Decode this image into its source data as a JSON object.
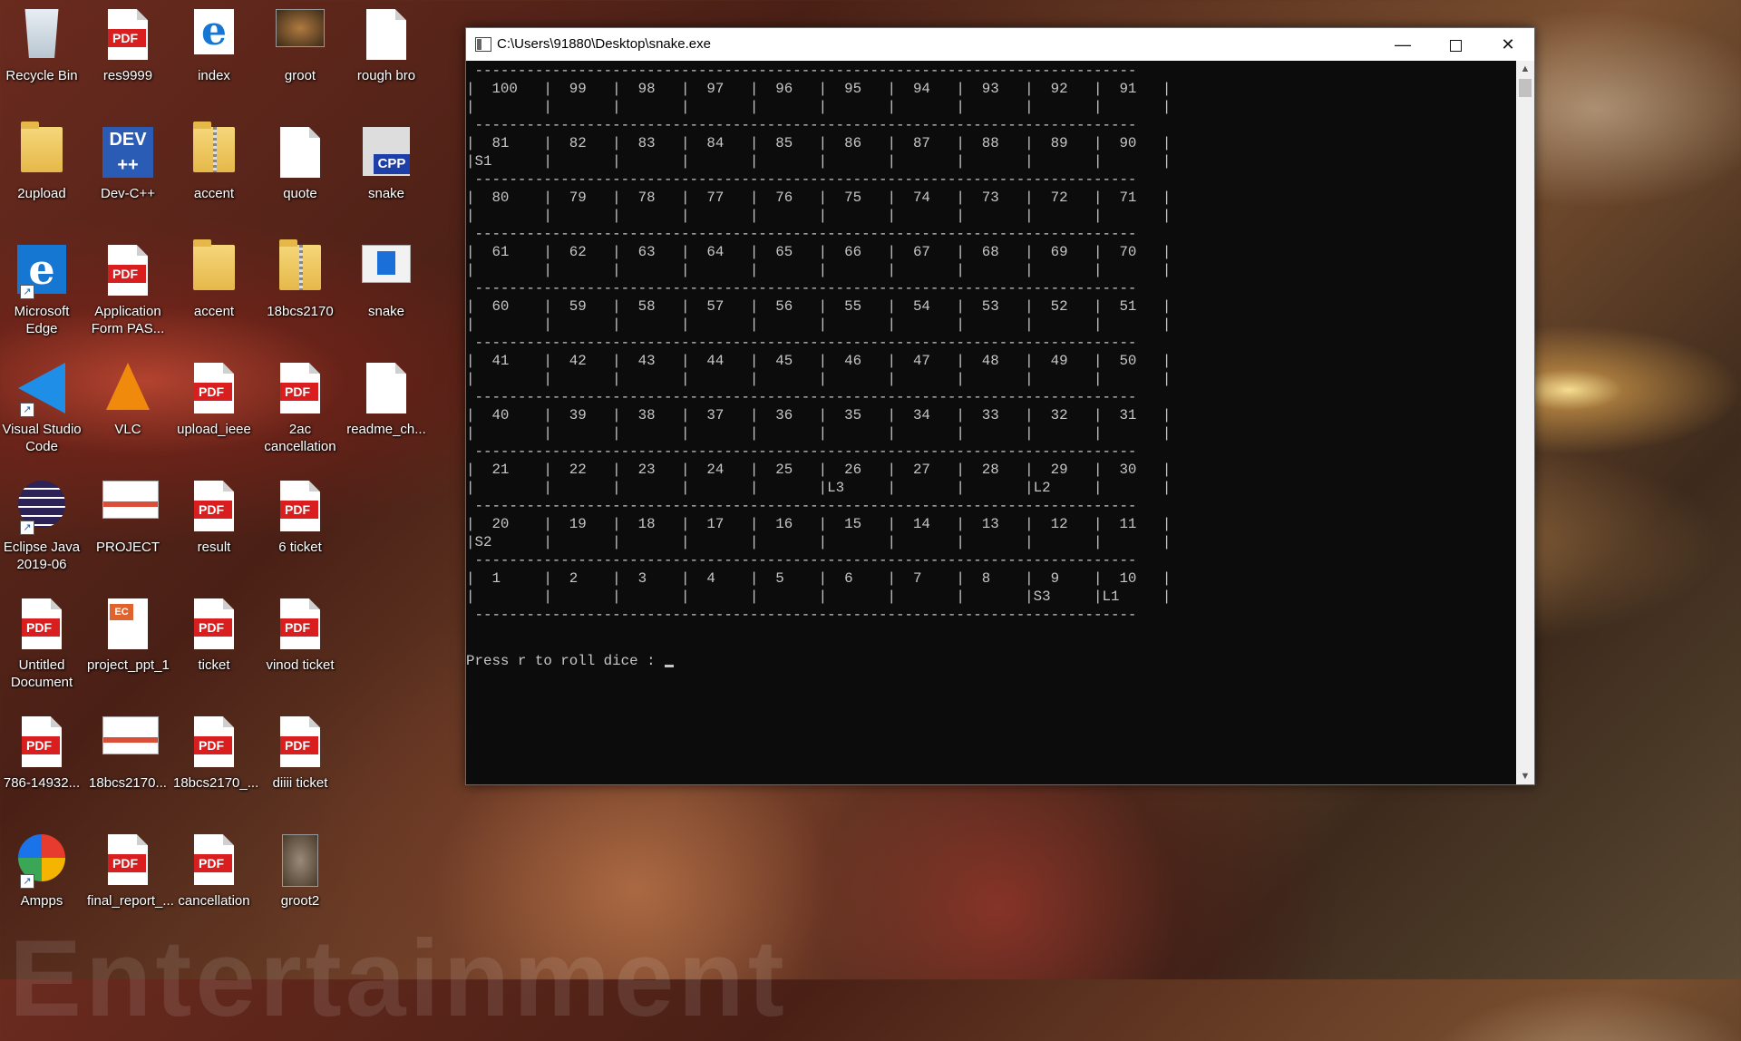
{
  "desktop": {
    "watermark": "Entertainment",
    "icons": [
      {
        "label": "Recycle Bin",
        "icon": "recycle-bin-icon"
      },
      {
        "label": "res9999",
        "icon": "pdf-icon"
      },
      {
        "label": "index",
        "icon": "edge-html-icon"
      },
      {
        "label": "groot",
        "icon": "image-icon"
      },
      {
        "label": "rough bro",
        "icon": "blank-file-icon"
      },
      {
        "label": "2upload",
        "icon": "folder-icon"
      },
      {
        "label": "Dev-C++",
        "icon": "devcpp-icon"
      },
      {
        "label": "accent",
        "icon": "zip-folder-icon"
      },
      {
        "label": "quote",
        "icon": "blank-file-icon"
      },
      {
        "label": "snake",
        "icon": "cpp-file-icon"
      },
      {
        "label": "Microsoft Edge",
        "icon": "edge-icon"
      },
      {
        "label": "Application Form PAS...",
        "icon": "pdf-icon"
      },
      {
        "label": "accent",
        "icon": "folder-icon"
      },
      {
        "label": "18bcs2170",
        "icon": "zip-folder-icon"
      },
      {
        "label": "snake",
        "icon": "exe-icon"
      },
      {
        "label": "Visual Studio Code",
        "icon": "vscode-icon"
      },
      {
        "label": "VLC",
        "icon": "vlc-icon"
      },
      {
        "label": "upload_ieee",
        "icon": "pdf-icon"
      },
      {
        "label": "2ac cancellation",
        "icon": "pdf-icon"
      },
      {
        "label": "readme_ch...",
        "icon": "blank-file-icon"
      },
      {
        "label": "Eclipse Java 2019-06",
        "icon": "eclipse-icon"
      },
      {
        "label": "PROJECT",
        "icon": "document-thumbnail-icon"
      },
      {
        "label": "result",
        "icon": "pdf-icon"
      },
      {
        "label": "6 ticket",
        "icon": "pdf-icon"
      },
      {
        "label": "Untitled Document",
        "icon": "pdf-icon"
      },
      {
        "label": "project_ppt_1",
        "icon": "ppt-icon"
      },
      {
        "label": "ticket",
        "icon": "pdf-icon"
      },
      {
        "label": "vinod ticket",
        "icon": "pdf-icon"
      },
      {
        "label": "786-14932...",
        "icon": "pdf-icon"
      },
      {
        "label": "18bcs2170...",
        "icon": "document-thumbnail-icon"
      },
      {
        "label": "18bcs2170_...",
        "icon": "pdf-icon"
      },
      {
        "label": "diiii ticket",
        "icon": "pdf-icon"
      },
      {
        "label": "Ampps",
        "icon": "ampps-icon"
      },
      {
        "label": "final_report_...",
        "icon": "pdf-icon"
      },
      {
        "label": "cancellation",
        "icon": "pdf-icon"
      },
      {
        "label": "groot2",
        "icon": "image-icon"
      }
    ]
  },
  "window": {
    "title": "C:\\Users\\91880\\Desktop\\snake.exe",
    "minimize_label": "—",
    "close_label": "✕",
    "board": [
      " -----------------------------------------------------------------------------",
      "|  100   |  99   |  98   |  97   |  96   |  95   |  94   |  93   |  92   |  91   |",
      "|        |       |       |       |       |       |       |       |       |       |",
      " -----------------------------------------------------------------------------",
      "|  81    |  82   |  83   |  84   |  85   |  86   |  87   |  88   |  89   |  90   |",
      "|S1      |       |       |       |       |       |       |       |       |       |",
      " -----------------------------------------------------------------------------",
      "|  80    |  79   |  78   |  77   |  76   |  75   |  74   |  73   |  72   |  71   |",
      "|        |       |       |       |       |       |       |       |       |       |",
      " -----------------------------------------------------------------------------",
      "|  61    |  62   |  63   |  64   |  65   |  66   |  67   |  68   |  69   |  70   |",
      "|        |       |       |       |       |       |       |       |       |       |",
      " -----------------------------------------------------------------------------",
      "|  60    |  59   |  58   |  57   |  56   |  55   |  54   |  53   |  52   |  51   |",
      "|        |       |       |       |       |       |       |       |       |       |",
      " -----------------------------------------------------------------------------",
      "|  41    |  42   |  43   |  44   |  45   |  46   |  47   |  48   |  49   |  50   |",
      "|        |       |       |       |       |       |       |       |       |       |",
      " -----------------------------------------------------------------------------",
      "|  40    |  39   |  38   |  37   |  36   |  35   |  34   |  33   |  32   |  31   |",
      "|        |       |       |       |       |       |       |       |       |       |",
      " -----------------------------------------------------------------------------",
      "|  21    |  22   |  23   |  24   |  25   |  26   |  27   |  28   |  29   |  30   |",
      "|        |       |       |       |       |L3     |       |       |L2     |       |",
      " -----------------------------------------------------------------------------",
      "|  20    |  19   |  18   |  17   |  16   |  15   |  14   |  13   |  12   |  11   |",
      "|S2      |       |       |       |       |       |       |       |       |       |",
      " -----------------------------------------------------------------------------",
      "|  1     |  2    |  3    |  4    |  5    |  6    |  7    |  8    |  9    |  10   |",
      "|        |       |       |       |       |       |       |       |S3     |L1     |",
      " -----------------------------------------------------------------------------"
    ],
    "prompt": "Press r to roll dice :"
  }
}
